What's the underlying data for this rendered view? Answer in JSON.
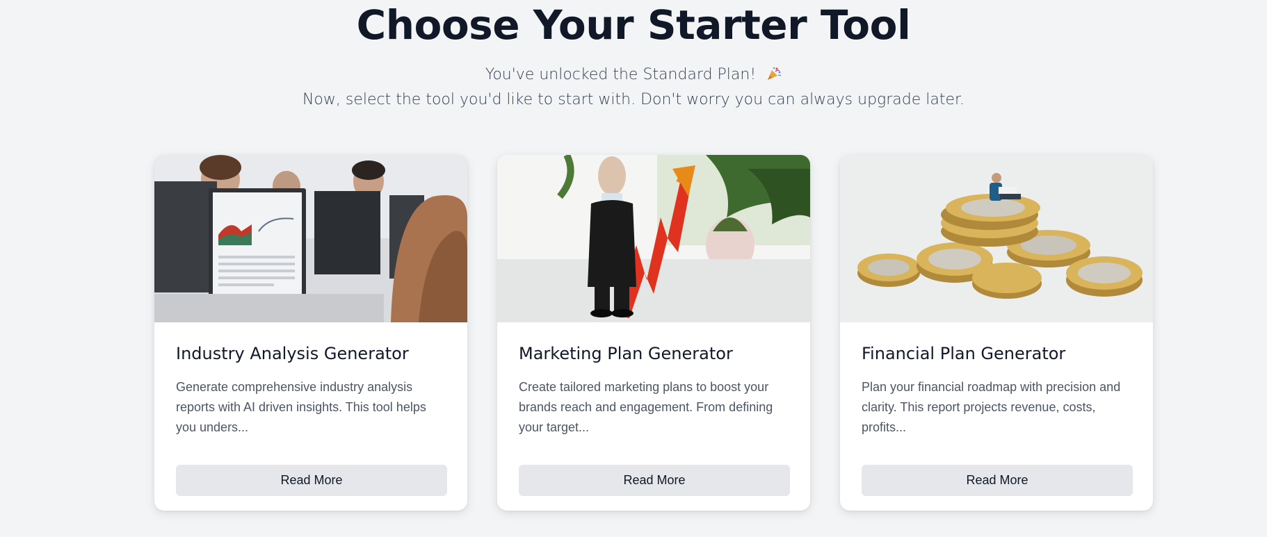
{
  "header": {
    "title": "Choose Your Starter Tool",
    "subtitle_line1": "You've unlocked the Standard Plan!",
    "subtitle_line2": "Now, select the tool you'd like to start with. Don't worry you can always upgrade later.",
    "celebration_icon": "party-popper-icon"
  },
  "cards": [
    {
      "title": "Industry Analysis Generator",
      "description": "Generate comprehensive industry analysis reports with AI driven insights. This tool helps you unders...",
      "button_label": "Read More"
    },
    {
      "title": "Marketing Plan Generator",
      "description": "Create tailored marketing plans to boost your brands reach and engagement. From defining your target...",
      "button_label": "Read More"
    },
    {
      "title": "Financial Plan Generator",
      "description": "Plan your financial roadmap with precision and clarity. This report projects revenue, costs, profits...",
      "button_label": "Read More"
    }
  ],
  "colors": {
    "background": "#f3f4f6",
    "title": "#111827",
    "button_bg": "#e5e7eb",
    "description": "#4b5563"
  }
}
